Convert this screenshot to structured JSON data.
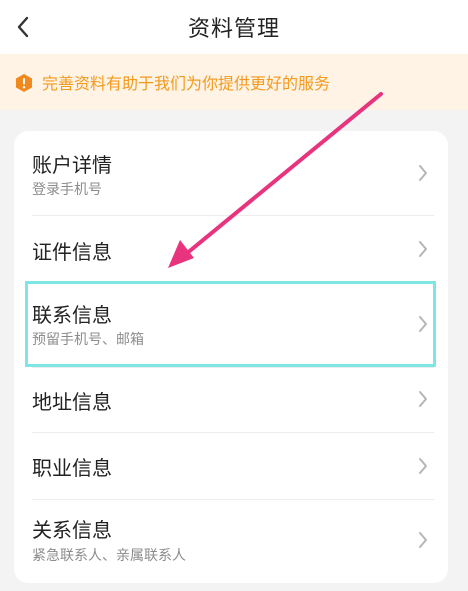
{
  "header": {
    "title": "资料管理"
  },
  "notice": {
    "text": "完善资料有助于我们为你提供更好的服务",
    "color": "#f39a1d"
  },
  "menu": {
    "items": [
      {
        "label": "账户详情",
        "sublabel": "登录手机号"
      },
      {
        "label": "证件信息",
        "sublabel": ""
      },
      {
        "label": "联系信息",
        "sublabel": "预留手机号、邮箱"
      },
      {
        "label": "地址信息",
        "sublabel": ""
      },
      {
        "label": "职业信息",
        "sublabel": ""
      },
      {
        "label": "关系信息",
        "sublabel": "紧急联系人、亲属联系人"
      }
    ]
  },
  "icons": {
    "back": "chevron-left-icon",
    "notice": "warning-hexagon-icon",
    "row": "chevron-right-icon"
  },
  "annotation": {
    "arrow_color": "#e8347f",
    "highlight_color": "#7ee7e5"
  }
}
